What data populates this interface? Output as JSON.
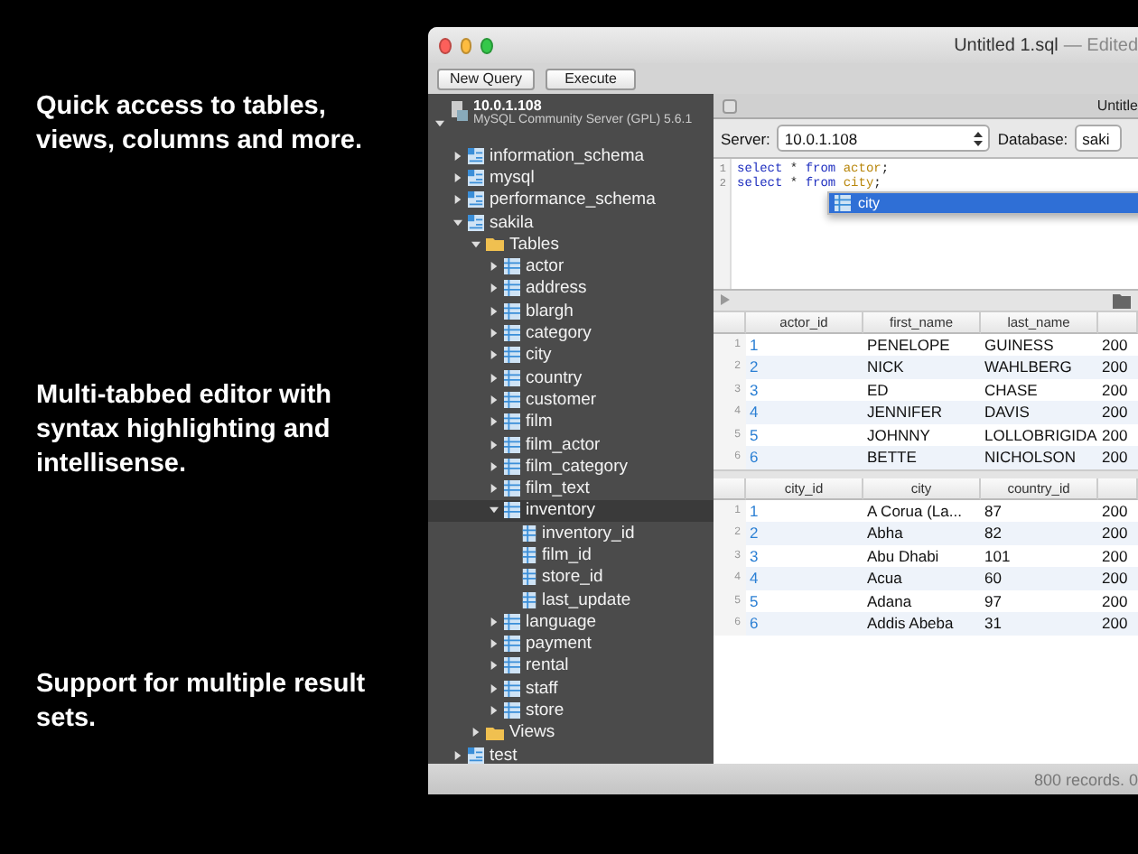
{
  "promo": [
    "Quick access to tables, views, columns and more.",
    "Multi-tabbed editor with syntax highlighting and intellisense.",
    "Support for multiple result sets."
  ],
  "window": {
    "title": "Untitled 1.sql",
    "subtitle": "— Edited"
  },
  "toolbar": [
    "New Query",
    "Execute"
  ],
  "server": {
    "name": "10.0.1.108",
    "description": "MySQL Community Server (GPL) 5.6.1",
    "expanded": true
  },
  "tree": [
    {
      "label": "information_schema",
      "kind": "database",
      "expanded": false,
      "selected": false
    },
    {
      "label": "mysql",
      "kind": "database",
      "expanded": false,
      "selected": false
    },
    {
      "label": "performance_schema",
      "kind": "database",
      "expanded": false,
      "selected": false
    },
    {
      "label": "sakila",
      "kind": "database",
      "expanded": true,
      "selected": false,
      "children": [
        {
          "label": "Tables",
          "kind": "folder",
          "expanded": true,
          "selected": false,
          "children": [
            {
              "label": "actor",
              "kind": "table",
              "expanded": false,
              "selected": false
            },
            {
              "label": "address",
              "kind": "table",
              "expanded": false,
              "selected": false
            },
            {
              "label": "blargh",
              "kind": "table",
              "expanded": false,
              "selected": false
            },
            {
              "label": "category",
              "kind": "table",
              "expanded": false,
              "selected": false
            },
            {
              "label": "city",
              "kind": "table",
              "expanded": false,
              "selected": false
            },
            {
              "label": "country",
              "kind": "table",
              "expanded": false,
              "selected": false
            },
            {
              "label": "customer",
              "kind": "table",
              "expanded": false,
              "selected": false
            },
            {
              "label": "film",
              "kind": "table",
              "expanded": false,
              "selected": false
            },
            {
              "label": "film_actor",
              "kind": "table",
              "expanded": false,
              "selected": false
            },
            {
              "label": "film_category",
              "kind": "table",
              "expanded": false,
              "selected": false
            },
            {
              "label": "film_text",
              "kind": "table",
              "expanded": false,
              "selected": false
            },
            {
              "label": "inventory",
              "kind": "table",
              "expanded": true,
              "selected": true,
              "children": [
                {
                  "label": "inventory_id",
                  "kind": "column",
                  "selected": false
                },
                {
                  "label": "film_id",
                  "kind": "column",
                  "selected": false
                },
                {
                  "label": "store_id",
                  "kind": "column",
                  "selected": false
                },
                {
                  "label": "last_update",
                  "kind": "column",
                  "selected": false
                }
              ]
            },
            {
              "label": "language",
              "kind": "table",
              "expanded": false,
              "selected": false
            },
            {
              "label": "payment",
              "kind": "table",
              "expanded": false,
              "selected": false
            },
            {
              "label": "rental",
              "kind": "table",
              "expanded": false,
              "selected": false
            },
            {
              "label": "staff",
              "kind": "table",
              "expanded": false,
              "selected": false
            },
            {
              "label": "store",
              "kind": "table",
              "expanded": false,
              "selected": false
            }
          ]
        },
        {
          "label": "Views",
          "kind": "folder",
          "expanded": false,
          "selected": false
        }
      ]
    },
    {
      "label": "test",
      "kind": "database",
      "expanded": false,
      "selected": false
    }
  ],
  "tab": {
    "label": "Untitle"
  },
  "connection": {
    "server_label": "Server:",
    "server": "10.0.1.108",
    "database_label": "Database:",
    "database": "saki"
  },
  "editor": {
    "lines": [
      {
        "number": "1",
        "tokens": [
          {
            "text": "select",
            "kind": "keyword"
          },
          {
            "text": " * ",
            "kind": "operator"
          },
          {
            "text": "from",
            "kind": "keyword"
          },
          {
            "text": " actor",
            "kind": "identifier"
          },
          {
            "text": ";",
            "kind": "operator"
          }
        ]
      },
      {
        "number": "2",
        "tokens": [
          {
            "text": "select",
            "kind": "keyword"
          },
          {
            "text": " * ",
            "kind": "operator"
          },
          {
            "text": "from",
            "kind": "keyword"
          },
          {
            "text": " city",
            "kind": "identifier"
          },
          {
            "text": ";",
            "kind": "operator"
          }
        ]
      }
    ],
    "autocomplete": [
      {
        "label": "city",
        "selected": true
      }
    ]
  },
  "results": [
    {
      "columns": [
        "actor_id",
        "first_name",
        "last_name"
      ],
      "rows": [
        {
          "number": "1",
          "cells": [
            "1",
            "PENELOPE",
            "GUINESS",
            "200"
          ]
        },
        {
          "number": "2",
          "cells": [
            "2",
            "NICK",
            "WAHLBERG",
            "200"
          ]
        },
        {
          "number": "3",
          "cells": [
            "3",
            "ED",
            "CHASE",
            "200"
          ]
        },
        {
          "number": "4",
          "cells": [
            "4",
            "JENNIFER",
            "DAVIS",
            "200"
          ]
        },
        {
          "number": "5",
          "cells": [
            "5",
            "JOHNNY",
            "LOLLOBRIGIDA",
            "200"
          ]
        },
        {
          "number": "6",
          "cells": [
            "6",
            "BETTE",
            "NICHOLSON",
            "200"
          ]
        }
      ]
    },
    {
      "columns": [
        "city_id",
        "city",
        "country_id"
      ],
      "rows": [
        {
          "number": "1",
          "cells": [
            "1",
            "A Corua (La...",
            "87",
            "200"
          ]
        },
        {
          "number": "2",
          "cells": [
            "2",
            "Abha",
            "82",
            "200"
          ]
        },
        {
          "number": "3",
          "cells": [
            "3",
            "Abu Dhabi",
            "101",
            "200"
          ]
        },
        {
          "number": "4",
          "cells": [
            "4",
            "Acua",
            "60",
            "200"
          ]
        },
        {
          "number": "5",
          "cells": [
            "5",
            "Adana",
            "97",
            "200"
          ]
        },
        {
          "number": "6",
          "cells": [
            "6",
            "Addis Abeba",
            "31",
            "200"
          ]
        }
      ]
    }
  ],
  "status_bar": "800 records. 0"
}
